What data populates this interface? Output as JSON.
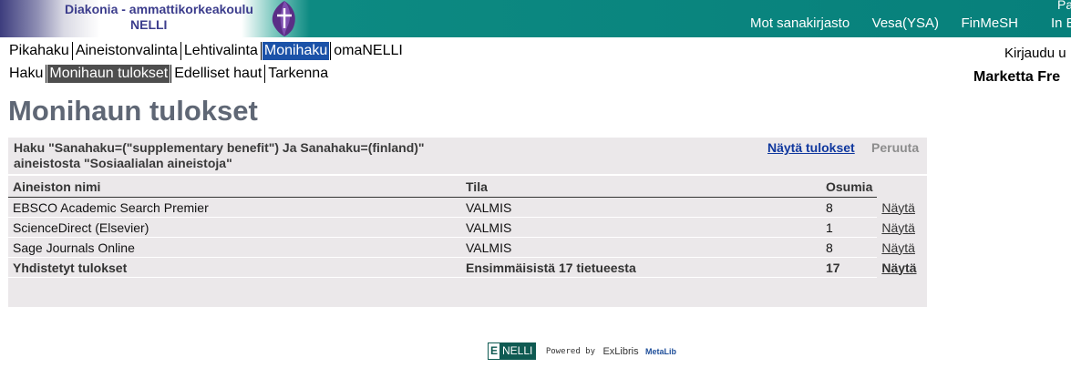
{
  "header": {
    "brand_line1": "Diakonia - ammattikorkeakoulu",
    "brand_line2": "NELLI",
    "links": [
      "Mot sanakirjasto",
      "Vesa(YSA)",
      "FinMeSH"
    ],
    "corner_top": "Pa",
    "corner_bottom": "In E",
    "logo_icon": "diak-flame-logo-icon"
  },
  "nav_primary": [
    "Pikahaku",
    "Aineistonvalinta",
    "Lehtivalinta",
    "Monihaku",
    "omaNELLI"
  ],
  "nav_secondary": [
    "Haku",
    "Monihaun tulokset",
    "Edelliset haut",
    "Tarkenna"
  ],
  "user": {
    "login_text": "Kirjaudu u",
    "name": "Marketta Fre"
  },
  "page_title": "Monihaun tulokset",
  "query": {
    "line1": "Haku \"Sanahaku=(\"supplementary benefit\") Ja Sanahaku=(finland)\"",
    "line2": "aineistosta \"Sosiaalialan aineistoja\"",
    "show_results": "Näytä tulokset",
    "cancel": "Peruuta"
  },
  "table": {
    "headers": [
      "Aineiston nimi",
      "Tila",
      "Osumia"
    ],
    "rows": [
      {
        "name": "EBSCO Academic Search Premier",
        "status": "VALMIS",
        "hits": "8",
        "link": "Näytä"
      },
      {
        "name": "ScienceDirect (Elsevier)",
        "status": "VALMIS",
        "hits": "1",
        "link": "Näytä"
      },
      {
        "name": "Sage Journals Online",
        "status": "VALMIS",
        "hits": "8",
        "link": "Näytä"
      }
    ],
    "total": {
      "name": "Yhdistetyt tulokset",
      "status": "Ensimmäisistä 17 tietueesta",
      "hits": "17",
      "link": "Näytä"
    }
  },
  "footer": {
    "badge_letter": "E",
    "badge_text": "NELLI",
    "powered_by": "Powered by",
    "exlibris": "ExLibris",
    "metalib": "MetaLib"
  },
  "colors": {
    "header_teal": "#07807b",
    "brand_text": "#3b3c8c",
    "nav_active_blue": "#1b52a8",
    "nav_active_grey": "#4e4e4e",
    "title_grey": "#5f6775",
    "panel_bg": "#ebe8ea",
    "link_blue": "#10389e"
  }
}
